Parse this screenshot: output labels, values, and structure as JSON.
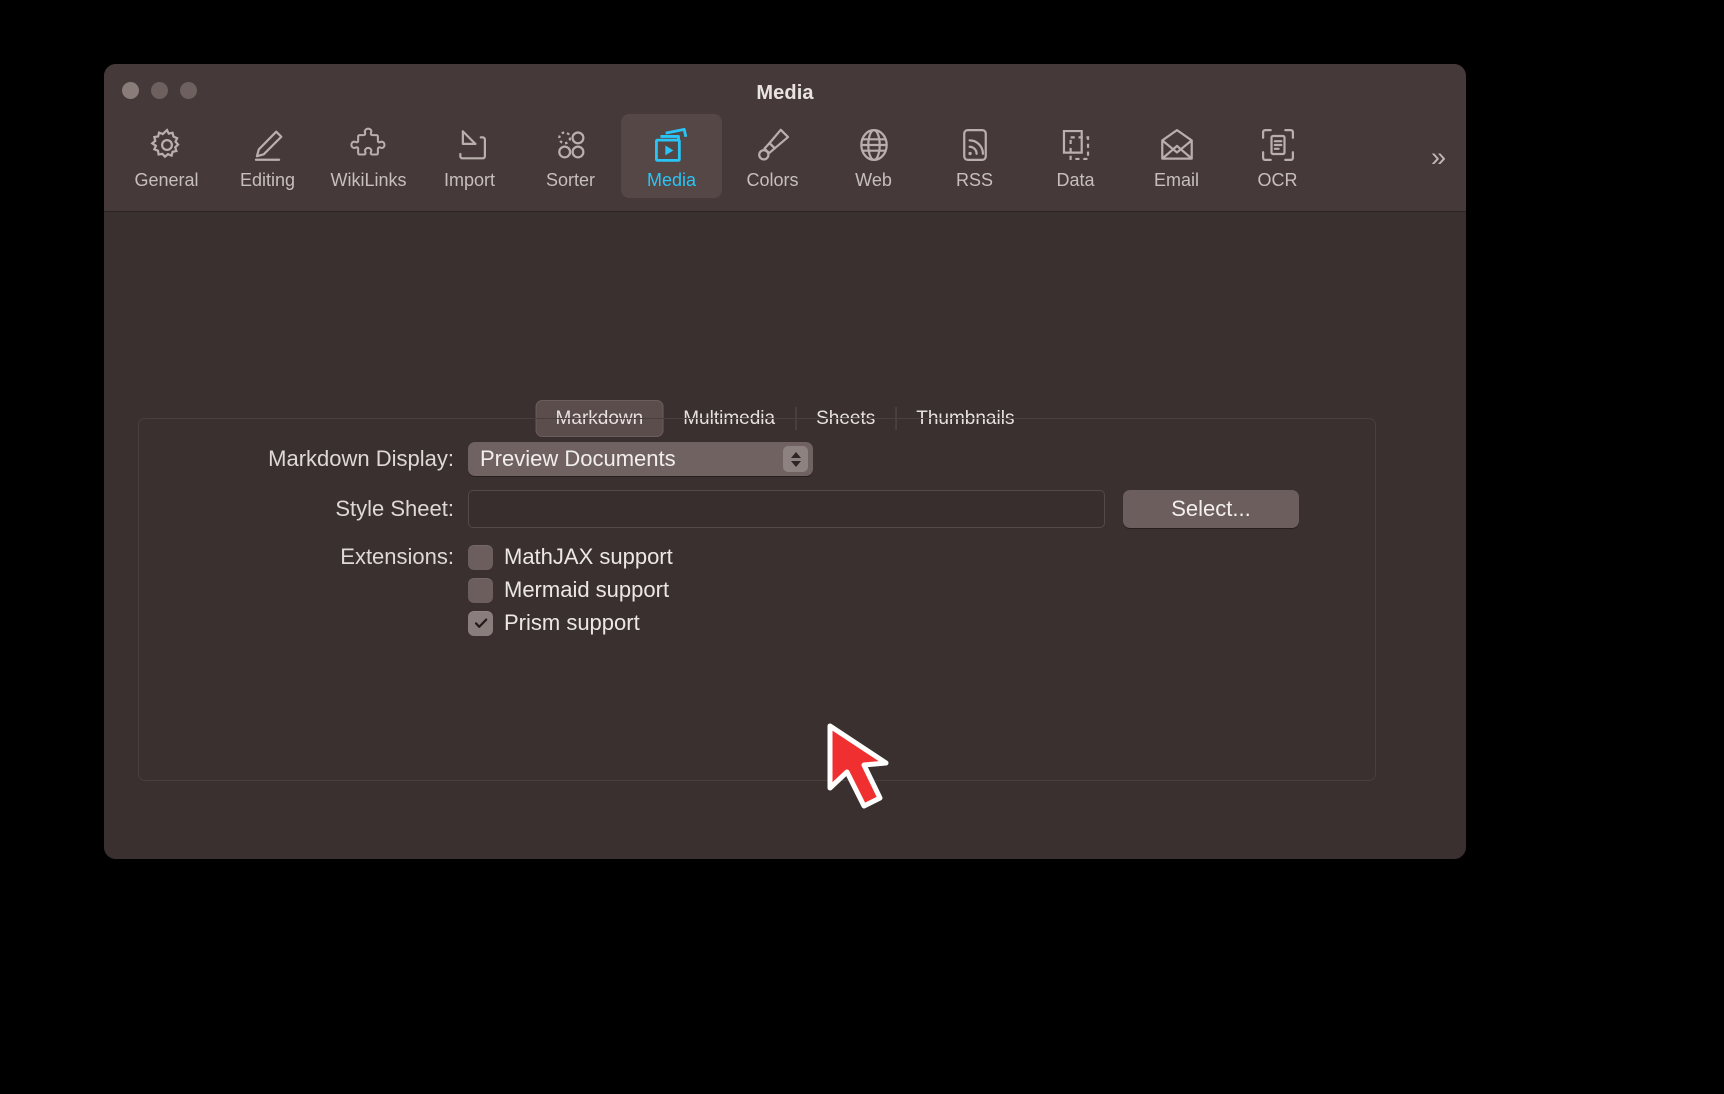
{
  "window": {
    "title": "Media",
    "traffic_lights": [
      "close",
      "minimize",
      "maximize"
    ]
  },
  "toolbar": {
    "overflow_label": "»",
    "selected": "Media",
    "items": [
      {
        "label": "General",
        "icon": "gear-icon"
      },
      {
        "label": "Editing",
        "icon": "pencil-icon"
      },
      {
        "label": "WikiLinks",
        "icon": "puzzle-piece-icon"
      },
      {
        "label": "Import",
        "icon": "import-arrow-icon"
      },
      {
        "label": "Sorter",
        "icon": "sorter-dots-icon"
      },
      {
        "label": "Media",
        "icon": "media-play-icon"
      },
      {
        "label": "Colors",
        "icon": "paintbrush-icon"
      },
      {
        "label": "Web",
        "icon": "globe-icon"
      },
      {
        "label": "RSS",
        "icon": "rss-icon"
      },
      {
        "label": "Data",
        "icon": "data-frames-icon"
      },
      {
        "label": "Email",
        "icon": "envelope-icon"
      },
      {
        "label": "OCR",
        "icon": "ocr-scan-icon"
      }
    ]
  },
  "tabs": {
    "active": "Markdown",
    "items": [
      {
        "label": "Markdown"
      },
      {
        "label": "Multimedia"
      },
      {
        "label": "Sheets"
      },
      {
        "label": "Thumbnails"
      }
    ]
  },
  "form": {
    "markdown_display": {
      "label": "Markdown Display:",
      "value": "Preview Documents",
      "options": [
        "Preview Documents"
      ]
    },
    "style_sheet": {
      "label": "Style Sheet:",
      "value": "",
      "placeholder": "",
      "select_button": "Select..."
    },
    "extensions": {
      "label": "Extensions:",
      "items": [
        {
          "label": "MathJAX support",
          "checked": false
        },
        {
          "label": "Mermaid support",
          "checked": false
        },
        {
          "label": "Prism support",
          "checked": true
        }
      ]
    }
  },
  "help_button": {
    "label": "?"
  },
  "colors": {
    "accent": "#29c5f6",
    "window_bg": "#3a302f",
    "titlebar_bg": "#453a39",
    "control_bg": "#6b5e5c",
    "text": "#ece7e5",
    "annotation_arrow": "#f03030"
  }
}
